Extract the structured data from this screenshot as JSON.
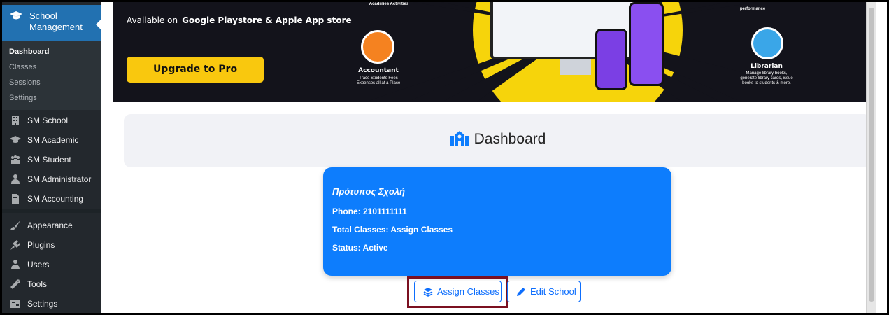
{
  "sidebar": {
    "plugin_title": "School Management",
    "submenu": [
      "Dashboard",
      "Classes",
      "Sessions",
      "Settings"
    ],
    "items": [
      {
        "label": "SM School",
        "icon": "building-icon"
      },
      {
        "label": "SM Academic",
        "icon": "graduation-cap-icon"
      },
      {
        "label": "SM Student",
        "icon": "students-icon"
      },
      {
        "label": "SM Administrator",
        "icon": "user-tie-icon"
      },
      {
        "label": "SM Accounting",
        "icon": "document-icon"
      }
    ],
    "wp_items": [
      {
        "label": "Appearance",
        "icon": "brush-icon"
      },
      {
        "label": "Plugins",
        "icon": "plug-icon"
      },
      {
        "label": "Users",
        "icon": "users-icon"
      },
      {
        "label": "Tools",
        "icon": "wrench-icon"
      },
      {
        "label": "Settings",
        "icon": "settings-icon"
      }
    ]
  },
  "banner": {
    "available_prefix": "Available on",
    "available_stores": "Google Playstore & Apple App store",
    "upgrade_button": "Upgrade to Pro",
    "top_left_caption": "Acadmies Activities",
    "top_right_caption": "performance",
    "accountant_title": "Accountant",
    "accountant_desc_1": "Trace Students Fees",
    "accountant_desc_2": "Expenses all at a Place",
    "librarian_title": "Librarian",
    "librarian_desc_1": "Manage library books,",
    "librarian_desc_2": "generate library cards, issue",
    "librarian_desc_3": "books to students & more."
  },
  "dashboard": {
    "title": "Dashboard"
  },
  "school_card": {
    "name": "Πρότυπος Σχολή",
    "phone": "Phone: 2101111111",
    "total_classes": "Total Classes: Assign Classes",
    "status": "Status: Active"
  },
  "actions": {
    "assign_classes": "Assign Classes",
    "edit_school": "Edit School"
  },
  "colors": {
    "sidebar_bg": "#23282d",
    "sidebar_active": "#2271b1",
    "card_bg": "#0d7dfd",
    "button_primary": "#0d6efd",
    "banner_yellow": "#f9c80e",
    "highlight_box": "#7b1020"
  }
}
